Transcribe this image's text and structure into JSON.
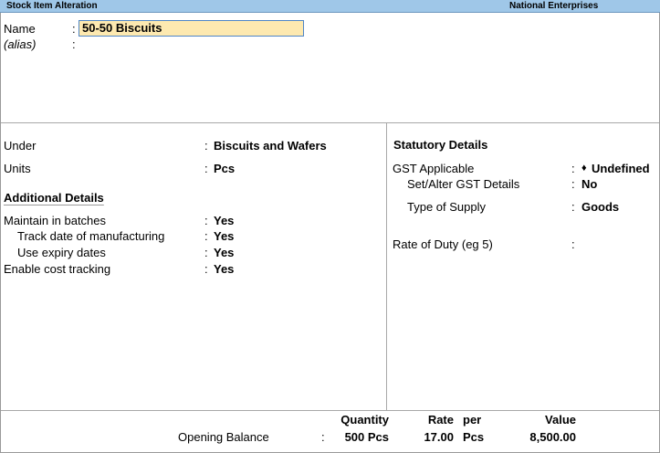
{
  "window": {
    "title": "Stock Item Alteration",
    "company": "National Enterprises"
  },
  "header": {
    "name_label": "Name",
    "name_value": "50-50 Biscuits",
    "alias_label": "(alias)",
    "colon": ":"
  },
  "left": {
    "under_label": "Under",
    "under_value": "Biscuits and Wafers",
    "units_label": "Units",
    "units_value": "Pcs",
    "additional_title": "Additional Details",
    "batches_label": "Maintain in batches",
    "batches_value": "Yes",
    "track_mfg_label": "Track date of manufacturing",
    "track_mfg_value": "Yes",
    "expiry_label": "Use expiry dates",
    "expiry_value": "Yes",
    "cost_label": "Enable cost tracking",
    "cost_value": "Yes"
  },
  "right": {
    "statutory_title": "Statutory Details",
    "gst_label": "GST Applicable",
    "gst_value": "Undefined",
    "gst_bullet": "♦",
    "set_gst_label": "Set/Alter GST Details",
    "set_gst_value": "No",
    "supply_label": "Type of Supply",
    "supply_value": "Goods",
    "duty_label": "Rate of Duty (eg 5)",
    "duty_value": ""
  },
  "footer": {
    "quantity_header": "Quantity",
    "rate_header": "Rate",
    "per_header": "per",
    "value_header": "Value",
    "opening_label": "Opening Balance",
    "opening_qty": "500 Pcs",
    "opening_rate": "17.00",
    "opening_per": "Pcs",
    "opening_value": "8,500.00"
  }
}
